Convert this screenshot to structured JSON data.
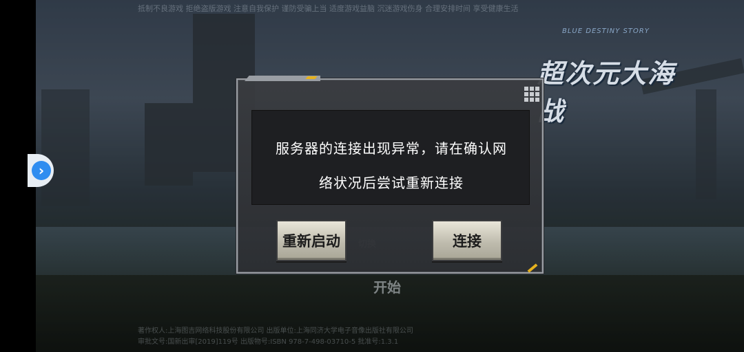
{
  "game": {
    "logo_subtitle": "BLUE DESTINY STORY",
    "logo_title": "超次元大海战"
  },
  "notice": {
    "top_text": "抵制不良游戏 拒绝盗版游戏 注意自我保护 谨防受骗上当 适度游戏益脑 沉迷游戏伤身 合理安排时间 享受健康生活",
    "copyright_line1": "著作权人:上海图吉网络科技股份有限公司 出版单位:上海同济大学电子音像出版社有限公司",
    "copyright_line2": "审批文号:国新出审[2019]119号 出版物号:ISBN 978-7-498-03710-5 批准号:1.3.1"
  },
  "background": {
    "start_label": "开始",
    "faint_label": "切换"
  },
  "dialog": {
    "message_line1": "服务器的连接出现异常，请在确认网",
    "message_line2": "络状况后尝试重新连接",
    "restart_label": "重新启动",
    "connect_label": "连接"
  },
  "colors": {
    "accent": "#e6b21e",
    "dialog_border": "#9a9ea4",
    "side_button": "#2f8df0"
  },
  "icons": {
    "side_arrow": "chevron-right-icon",
    "dialog_corner": "grid-icon"
  }
}
